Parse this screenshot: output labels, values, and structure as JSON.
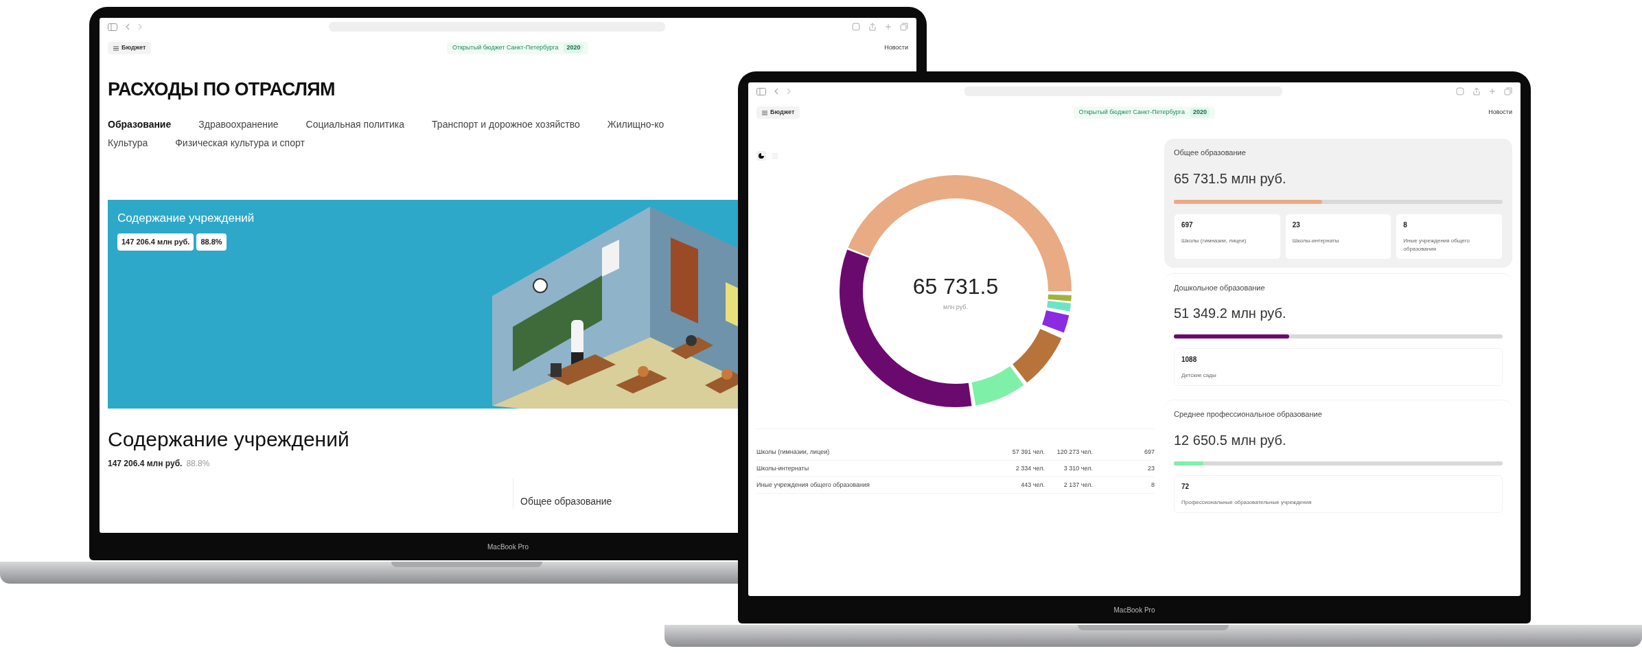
{
  "left_laptop": {
    "model_label": "MacBook Pro",
    "header": {
      "menu_button": "Бюджет",
      "site_title": "Открытый бюджет Санкт-Петербурга",
      "year": "2020",
      "news_link": "Новости"
    },
    "page_title": "РАСХОДЫ ПО ОТРАСЛЯМ",
    "tabs": [
      {
        "label": "Образование",
        "selected": true
      },
      {
        "label": "Здравоохранение",
        "selected": false
      },
      {
        "label": "Социальная политика",
        "selected": false
      },
      {
        "label": "Транспорт и дорожное хозяйство",
        "selected": false
      },
      {
        "label": "Жилищно-ко",
        "selected": false
      },
      {
        "label": "Культура",
        "selected": false
      },
      {
        "label": "Физическая культура и спорт",
        "selected": false
      }
    ],
    "banner": {
      "title": "Содержание учреждений",
      "amount": "147 206.4 млн руб.",
      "share": "88.8%"
    },
    "section": {
      "title": "Содержание учреждений",
      "amount": "147 206.4 млн руб.",
      "share": "88.8%"
    },
    "first_category": "Общее образование"
  },
  "right_laptop": {
    "model_label": "MacBook Pro",
    "header": {
      "menu_button": "Бюджет",
      "site_title": "Открытый бюджет Санкт-Петербурга",
      "year": "2020",
      "news_link": "Новости"
    },
    "donut": {
      "total": "65 731.5",
      "unit": "млн руб."
    },
    "table": {
      "rows": [
        {
          "column_1": "Школы (гимназии, лицеи)",
          "column_2": "57 391 чел.",
          "column_3": "120 273 чел.",
          "column_4": "697"
        },
        {
          "column_1": "Школы-интернаты",
          "column_2": "2 334 чел.",
          "column_3": "3 310 чел.",
          "column_4": "23"
        },
        {
          "column_1": "Иные учреждения общего образования",
          "column_2": "443 чел.",
          "column_3": "2 137 чел.",
          "column_4": "8"
        }
      ]
    },
    "categories": [
      {
        "title": "Общее образование",
        "amount": "65 731.5 млн руб.",
        "level": 0.45,
        "color": "#e8ab84",
        "highlighted": true,
        "stats": [
          {
            "value": "697",
            "label": "Школы (гимназии, лицеи)"
          },
          {
            "value": "23",
            "label": "Школы-интернаты"
          },
          {
            "value": "8",
            "label": "Иные учреждения общего образования"
          }
        ]
      },
      {
        "title": "Дошкольное образование",
        "amount": "51 349.2 млн руб.",
        "level": 0.35,
        "color": "#6b0a6e",
        "highlighted": false,
        "stats": [
          {
            "value": "1088",
            "label": "Детские сады"
          }
        ]
      },
      {
        "title": "Среднее профессиональное образование",
        "amount": "12 650.5 млн руб.",
        "level": 0.09,
        "color": "#7ef0a8",
        "highlighted": false,
        "stats": [
          {
            "value": "72",
            "label": "Профессиональные образовательные учреждения"
          }
        ]
      }
    ]
  }
}
